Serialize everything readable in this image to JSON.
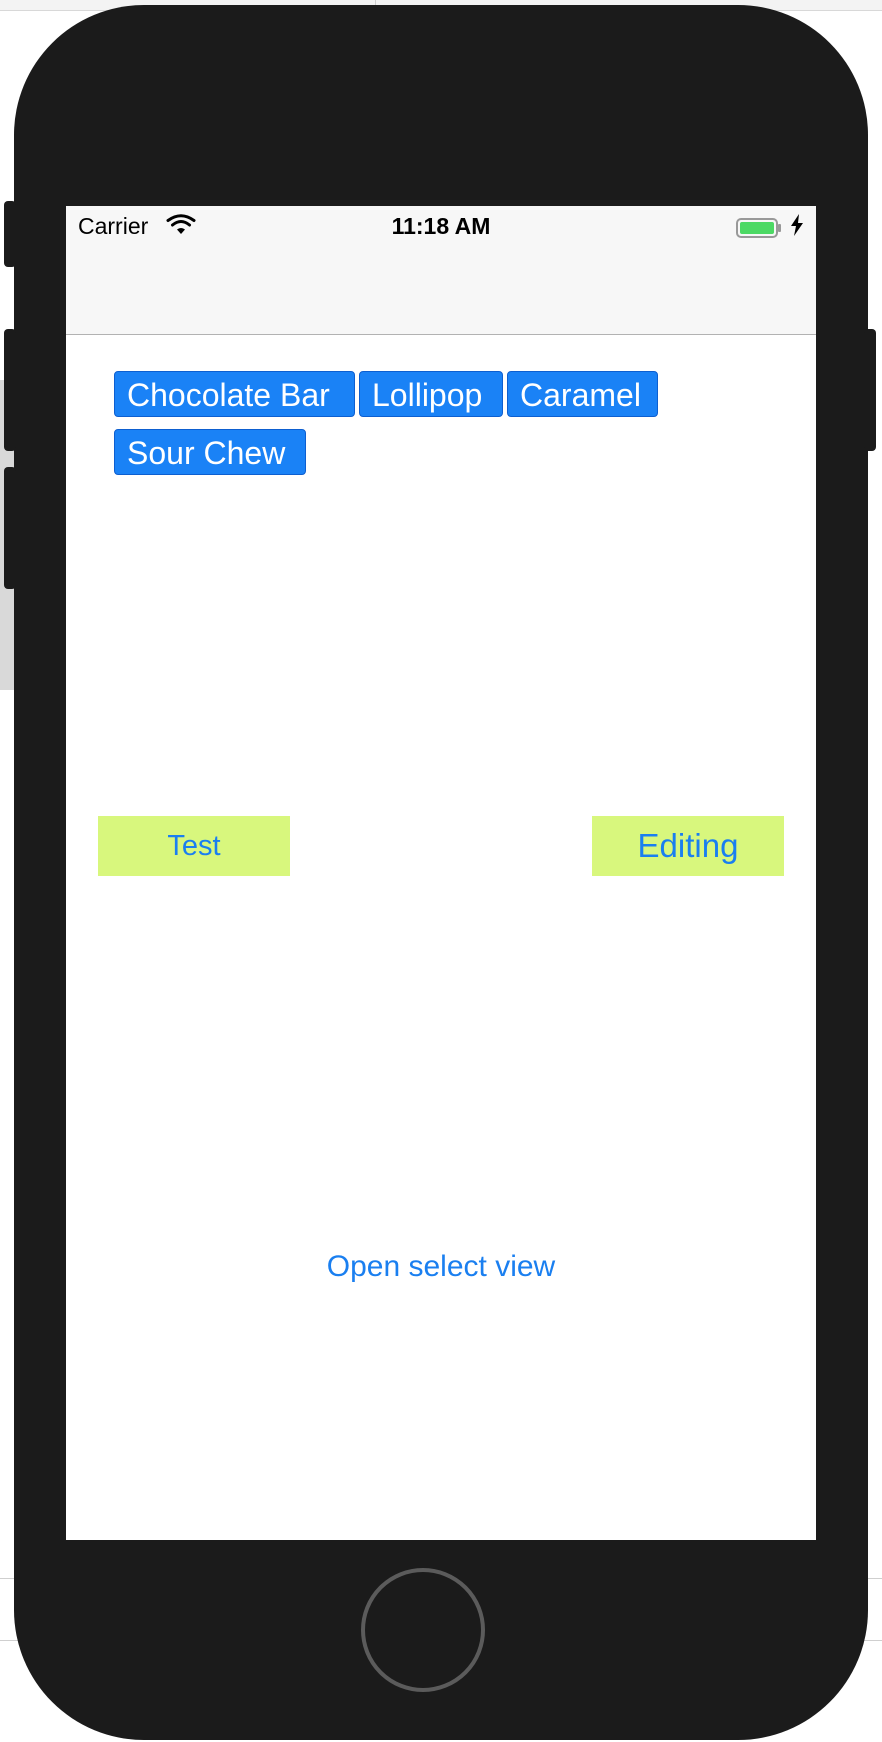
{
  "status_bar": {
    "carrier": "Carrier",
    "time": "11:18 AM",
    "wifi_icon": "wifi-icon",
    "battery_icon": "battery-full-icon",
    "charging_icon": "lightning-bolt-icon"
  },
  "tags": [
    {
      "label": "Chocolate Bar"
    },
    {
      "label": "Lollipop"
    },
    {
      "label": "Caramel"
    },
    {
      "label": "Sour Chew"
    }
  ],
  "buttons": {
    "test_label": "Test",
    "editing_label": "Editing",
    "open_select_label": "Open select view"
  },
  "colors": {
    "tag_background": "#1a82f6",
    "button_background": "#d8f77d",
    "link_text": "#1a7ff0",
    "device_body": "#1b1b1b"
  }
}
